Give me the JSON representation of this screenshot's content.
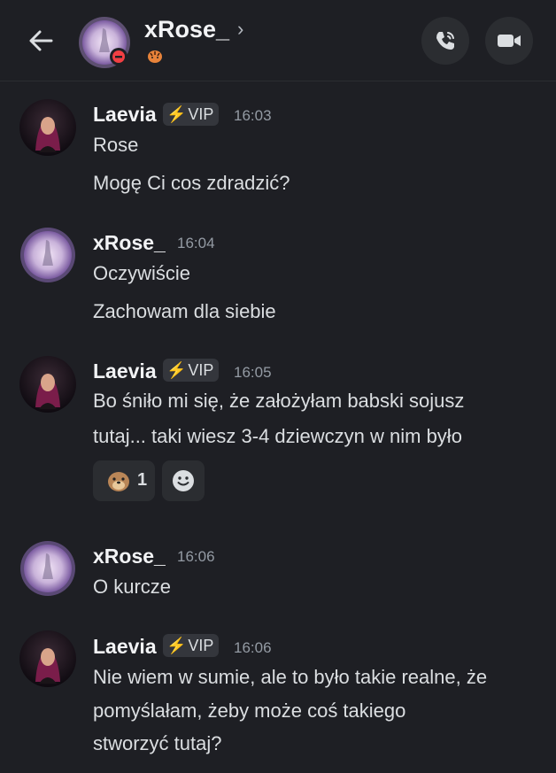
{
  "header": {
    "name": "xRose_",
    "chevron": "›",
    "status_emoji_icon": "tiger-emoji-icon",
    "call_icon": "phone-call-icon",
    "video_icon": "video-camera-icon",
    "back_icon": "arrow-left-icon"
  },
  "colors": {
    "background": "#1e1f24",
    "surface": "#2b2d31",
    "dnd_red": "#f23f43",
    "vip_yellow": "#f0b232"
  },
  "messages": [
    {
      "author": "Laevia",
      "badge": "VIP",
      "time": "16:03",
      "lines": [
        "Rose",
        "Mogę Ci cos zdradzić?"
      ]
    },
    {
      "author": "xRose_",
      "time": "16:04",
      "lines": [
        "Oczywiście",
        "Zachowam dla siebie"
      ]
    },
    {
      "author": "Laevia",
      "badge": "VIP",
      "time": "16:05",
      "lines": [
        "Bo śniło mi się, że założyłam babski sojusz",
        "tutaj... taki wiesz 3-4 dziewczyn w nim było"
      ],
      "reaction": {
        "emoji_icon": "otter-emoji-icon",
        "count": "1"
      }
    },
    {
      "author": "xRose_",
      "time": "16:06",
      "lines": [
        "O kurcze"
      ]
    },
    {
      "author": "Laevia",
      "badge": "VIP",
      "time": "16:06",
      "lines": [
        "Nie wiem w sumie, ale to było takie realne, że",
        "pomyślałam, żeby może coś takiego",
        "stworzyć tutaj?"
      ]
    }
  ]
}
